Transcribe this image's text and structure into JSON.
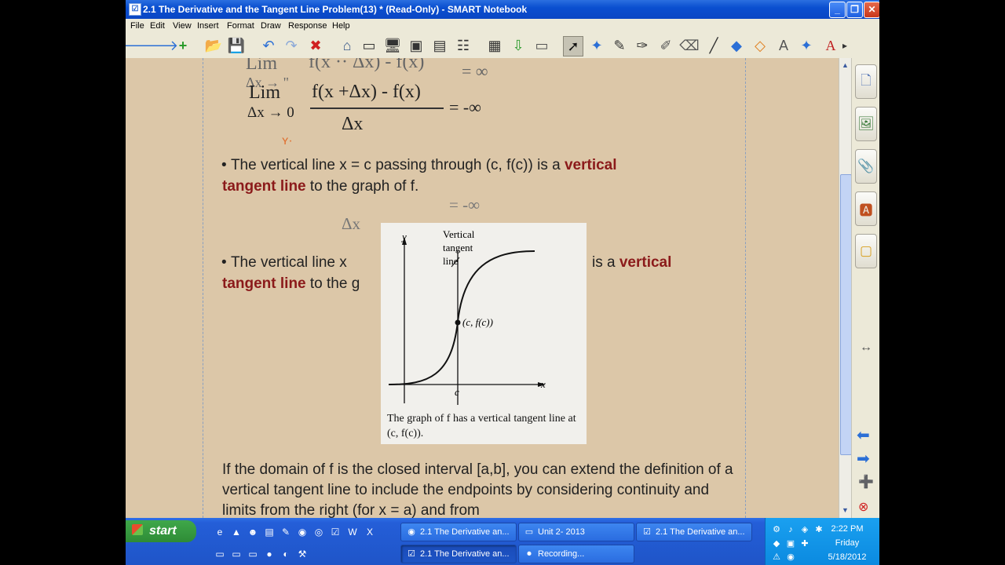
{
  "window": {
    "title": "2.1 The Derivative and the Tangent Line Problem(13) * (Read-Only) - SMART Notebook",
    "minimize": "_",
    "maximize": "❐",
    "close": "✕"
  },
  "menu": [
    "File",
    "Edit",
    "View",
    "Insert",
    "Format",
    "Draw",
    "Response",
    "Help"
  ],
  "toolbar": {
    "back_icon": "🡐",
    "forward_icon": "🡒",
    "add_page_icon": "+",
    "open_icon": "📂",
    "save_icon": "💾",
    "undo_icon": "↶",
    "redo_icon": "↷",
    "delete_icon": "✖",
    "capture_icon": "⌂",
    "screen_icon": "▭",
    "display_icon": "🖥",
    "camera_icon": "▣",
    "document_icon": "▤",
    "table_icon": "▦",
    "insert_icon": "⇩",
    "properties_icon": "☷",
    "select_icon": "➚",
    "pen_icon": "✎",
    "marker_icon": "✑",
    "highlighter_icon": "✐",
    "eraser_icon": "⌫",
    "line_icon": "╱",
    "shapes_icon": "◆",
    "fill_icon": "◇",
    "magic_pen_icon": "✦",
    "text_icon": "A",
    "more_icon": "▸"
  },
  "content": {
    "ink_lim1": "Lim",
    "ink_frac1": "f(x ·· Δx) - f(x)",
    "ink_result1": "= ∞",
    "ink_sub1": "Δx → \"",
    "ink_lim2": "Lim",
    "ink_frac2": "f(x +Δx) - f(x)",
    "ink_result2": "= -∞",
    "ink_sub2": "Δx → 0",
    "ink_den2": "Δx",
    "bullet1_pre": "The vertical line x = c passing through (c, f(c)) is a ",
    "bullet1_bold": "vertical",
    "bullet1_bold2": "tangent line",
    "bullet1_post": " to the graph of f.",
    "ghost_result": "= -∞",
    "ghost_den": "Δx",
    "bullet2_pre": "The vertical line x",
    "bullet2_mid": "is a ",
    "bullet2_bold": "vertical",
    "bullet2_bold2": "tangent line",
    "bullet2_post": " to the g",
    "paragraph": "If the domain of f is the closed interval [a,b], you can extend the definition of a vertical tangent line to include the endpoints by considering continuity and limits from the right (for x = a) and from"
  },
  "figure": {
    "label_y": "y",
    "label_x": "x",
    "label_c": "c",
    "label_vertical": "Vertical",
    "label_tangent": "tangent",
    "label_line": "line",
    "label_point": "(c, f(c))",
    "caption1": "The graph of f has a vertical tangent line at",
    "caption2": "(c, f(c))."
  },
  "sidepanel": {
    "page_sorter": "🗋",
    "gallery": "🖼",
    "attachments": "📎",
    "properties": "🅰",
    "addons": "▢",
    "resize": "↔",
    "prev": "⬅",
    "next": "➡",
    "add": "➕",
    "remove": "⊗"
  },
  "taskbar": {
    "start": "start",
    "tasks": [
      {
        "icon": "◉",
        "label": "2.1 The Derivative an..."
      },
      {
        "icon": "▭",
        "label": "Unit 2- 2013"
      },
      {
        "icon": "☑",
        "label": "2.1 The Derivative an..."
      },
      {
        "icon": "☑",
        "label": "2.1 The Derivative an..."
      },
      {
        "icon": "⏺",
        "label": "Recording..."
      }
    ],
    "clock_time": "2:22 PM",
    "clock_day": "Friday",
    "clock_date": "5/18/2012"
  }
}
